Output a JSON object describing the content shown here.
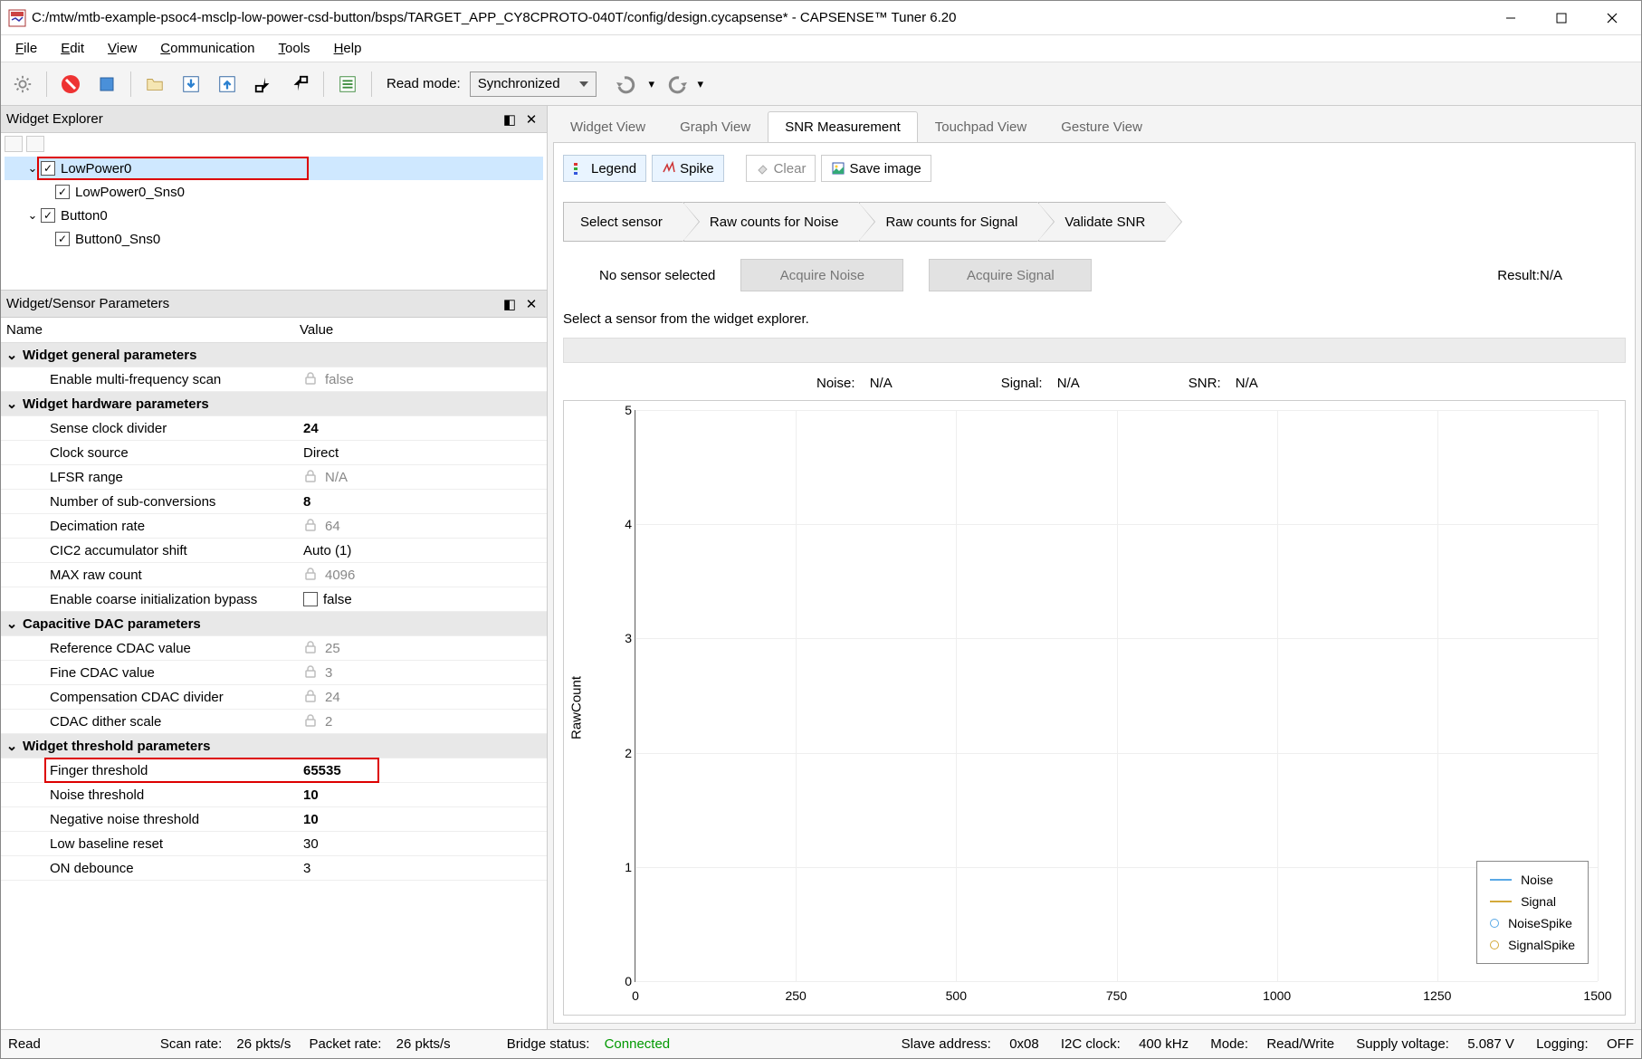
{
  "window": {
    "title": "C:/mtw/mtb-example-psoc4-msclp-low-power-csd-button/bsps/TARGET_APP_CY8CPROTO-040T/config/design.cycapsense* - CAPSENSE™ Tuner 6.20"
  },
  "menu": {
    "file": "File",
    "edit": "Edit",
    "view": "View",
    "communication": "Communication",
    "tools": "Tools",
    "help": "Help"
  },
  "toolbar": {
    "read_mode_label": "Read mode:",
    "read_mode_value": "Synchronized"
  },
  "widget_explorer": {
    "title": "Widget Explorer",
    "tree": [
      {
        "label": "LowPower0",
        "checked": true,
        "depth": 1,
        "expandable": true,
        "selected": true,
        "highlight": true
      },
      {
        "label": "LowPower0_Sns0",
        "checked": true,
        "depth": 2
      },
      {
        "label": "Button0",
        "checked": true,
        "depth": 1,
        "expandable": true
      },
      {
        "label": "Button0_Sns0",
        "checked": true,
        "depth": 2
      }
    ]
  },
  "params_panel": {
    "title": "Widget/Sensor Parameters",
    "col_name": "Name",
    "col_value": "Value",
    "groups": [
      {
        "name": "Widget general parameters",
        "rows": [
          {
            "name": "Enable multi-frequency scan",
            "value": "false",
            "locked": true
          }
        ]
      },
      {
        "name": "Widget hardware parameters",
        "rows": [
          {
            "name": "Sense clock divider",
            "value": "24",
            "bold": true
          },
          {
            "name": "Clock source",
            "value": "Direct"
          },
          {
            "name": "LFSR range",
            "value": "N/A",
            "locked": true
          },
          {
            "name": "Number of sub-conversions",
            "value": "8",
            "bold": true
          },
          {
            "name": "Decimation rate",
            "value": "64",
            "locked": true
          },
          {
            "name": "CIC2 accumulator shift",
            "value": "Auto (1)"
          },
          {
            "name": "MAX raw count",
            "value": "4096",
            "locked": true
          },
          {
            "name": "Enable coarse initialization bypass",
            "value": "false",
            "checkbox": true
          }
        ]
      },
      {
        "name": "Capacitive DAC parameters",
        "rows": [
          {
            "name": "Reference CDAC value",
            "value": "25",
            "locked": true
          },
          {
            "name": "Fine CDAC value",
            "value": "3",
            "locked": true
          },
          {
            "name": "Compensation CDAC divider",
            "value": "24",
            "locked": true
          },
          {
            "name": "CDAC dither scale",
            "value": "2",
            "locked": true
          }
        ]
      },
      {
        "name": "Widget threshold parameters",
        "rows": [
          {
            "name": "Finger threshold",
            "value": "65535",
            "bold": true,
            "highlight": true
          },
          {
            "name": "Noise threshold",
            "value": "10",
            "bold": true
          },
          {
            "name": "Negative noise threshold",
            "value": "10",
            "bold": true
          },
          {
            "name": "Low baseline reset",
            "value": "30"
          },
          {
            "name": "ON debounce",
            "value": "3"
          }
        ]
      }
    ]
  },
  "tabs": {
    "items": [
      {
        "label": "Widget View"
      },
      {
        "label": "Graph View"
      },
      {
        "label": "SNR Measurement",
        "active": true
      },
      {
        "label": "Touchpad View"
      },
      {
        "label": "Gesture View"
      }
    ]
  },
  "snr": {
    "toolbar": {
      "legend": "Legend",
      "spike": "Spike",
      "clear": "Clear",
      "save": "Save image"
    },
    "steps": [
      "Select sensor",
      "Raw counts for Noise",
      "Raw counts for Signal",
      "Validate SNR"
    ],
    "no_sensor": "No sensor selected",
    "acquire_noise": "Acquire Noise",
    "acquire_signal": "Acquire Signal",
    "result_label": "Result:N/A",
    "hint": "Select a sensor from the widget explorer.",
    "stats": {
      "noise_label": "Noise:",
      "noise_val": "N/A",
      "signal_label": "Signal:",
      "signal_val": "N/A",
      "snr_label": "SNR:",
      "snr_val": "N/A"
    },
    "legend": {
      "noise": "Noise",
      "signal": "Signal",
      "noisespike": "NoiseSpike",
      "signalspike": "SignalSpike"
    }
  },
  "chart_data": {
    "type": "line",
    "title": "",
    "xlabel": "",
    "ylabel": "RawCount",
    "xlim": [
      0,
      1500
    ],
    "ylim": [
      0,
      5
    ],
    "xticks": [
      0,
      250,
      500,
      750,
      1000,
      1250,
      1500
    ],
    "yticks": [
      0,
      1,
      2,
      3,
      4,
      5
    ],
    "series": [
      {
        "name": "Noise",
        "color": "#5aa9e6",
        "values": []
      },
      {
        "name": "Signal",
        "color": "#d4a93a",
        "values": []
      },
      {
        "name": "NoiseSpike",
        "color": "#5aa9e6",
        "marker": "o",
        "values": []
      },
      {
        "name": "SignalSpike",
        "color": "#d4a93a",
        "marker": "o",
        "values": []
      }
    ]
  },
  "statusbar": {
    "read": "Read",
    "scan_rate_label": "Scan rate:",
    "scan_rate_value": "26 pkts/s",
    "packet_rate_label": "Packet rate:",
    "packet_rate_value": "26 pkts/s",
    "bridge_label": "Bridge status:",
    "bridge_value": "Connected",
    "slave_label": "Slave address:",
    "slave_value": "0x08",
    "i2c_label": "I2C clock:",
    "i2c_value": "400 kHz",
    "mode_label": "Mode:",
    "mode_value": "Read/Write",
    "supply_label": "Supply voltage:",
    "supply_value": "5.087 V",
    "logging_label": "Logging:",
    "logging_value": "OFF"
  }
}
